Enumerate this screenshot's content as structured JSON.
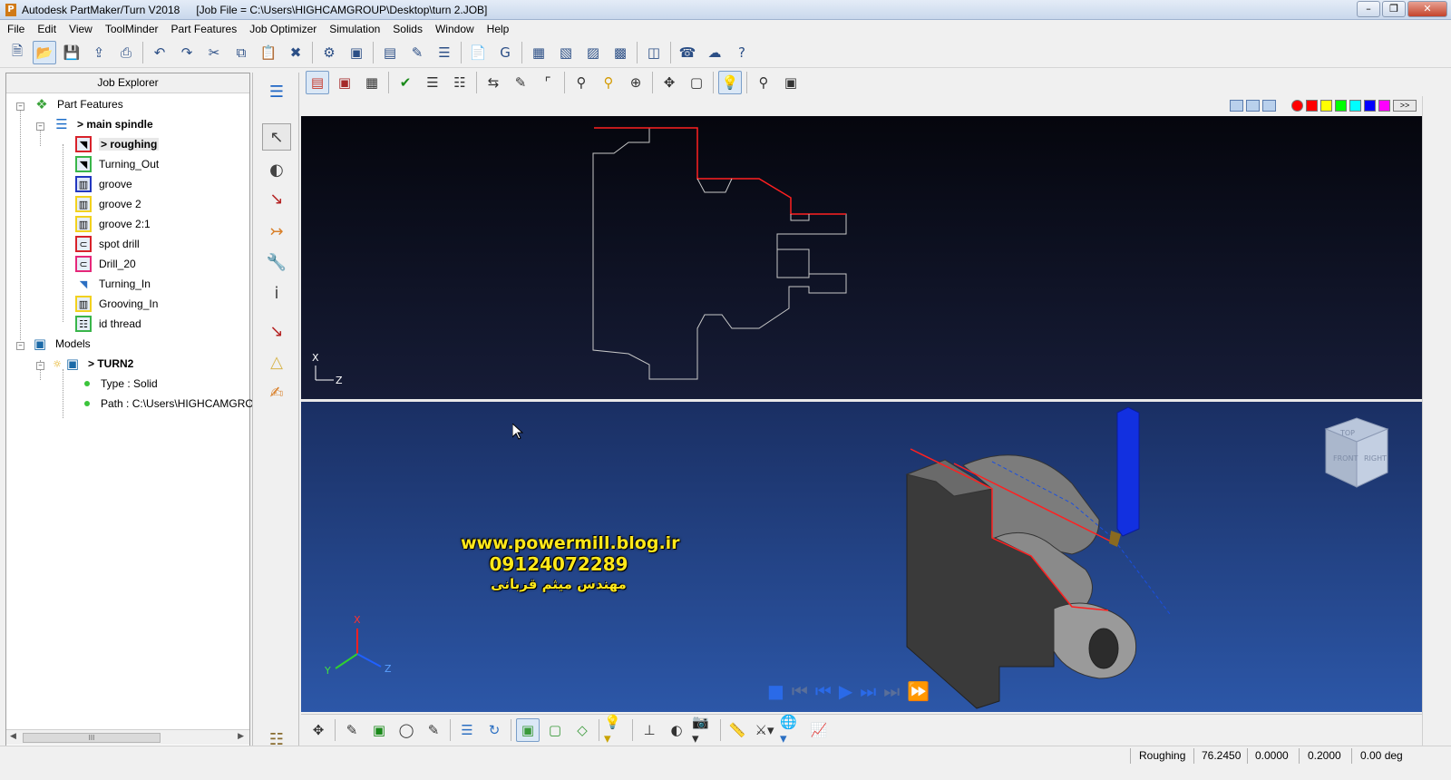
{
  "window": {
    "app_title": "Autodesk PartMaker/Turn V2018",
    "job_file": "[Job File = C:\\Users\\HIGHCAMGROUP\\Desktop\\turn 2.JOB]",
    "app_icon_letter": "P"
  },
  "menu": [
    "File",
    "Edit",
    "View",
    "ToolMinder",
    "Part Features",
    "Job Optimizer",
    "Simulation",
    "Solids",
    "Window",
    "Help"
  ],
  "explorer": {
    "title": "Job Explorer",
    "scroll_thumb": "III",
    "part_features": "Part Features",
    "main_spindle": "> main spindle",
    "features": [
      {
        "label": "> roughing",
        "color": "red",
        "icon": "turning-icon"
      },
      {
        "label": "Turning_Out",
        "color": "green",
        "icon": "turning-icon"
      },
      {
        "label": "groove",
        "color": "blue",
        "icon": "groove-icon"
      },
      {
        "label": "groove 2",
        "color": "yellow",
        "icon": "groove-icon"
      },
      {
        "label": "groove 2:1",
        "color": "yellow",
        "icon": "groove-icon"
      },
      {
        "label": "spot drill",
        "color": "red",
        "icon": "drill-icon"
      },
      {
        "label": "Drill_20",
        "color": "pink",
        "icon": "drill-icon"
      },
      {
        "label": "Turning_In",
        "color": "plain",
        "icon": "turning-icon"
      },
      {
        "label": "Grooving_In",
        "color": "yellow",
        "icon": "groove-icon"
      },
      {
        "label": "id thread",
        "color": "green",
        "icon": "thread-icon"
      }
    ],
    "models": "Models",
    "model_name": "> TURN2",
    "model_type": "Type : Solid",
    "model_path": "Path : C:\\Users\\HIGHCAMGRO"
  },
  "viewport_top": {
    "axis_x": "X",
    "axis_z": "Z"
  },
  "viewport_bottom": {
    "watermark_url": "www.powermill.blog.ir",
    "watermark_phone": "09124072289",
    "watermark_name": "مهندس میثم قربانی",
    "axis_x": "X",
    "axis_y": "Y",
    "axis_z": "Z",
    "cube_labels": [
      "TOP",
      "FRONT",
      "RIGHT"
    ]
  },
  "colors": {
    "swatches": [
      "#ff0000",
      "#ff0000",
      "#ffff00",
      "#00ff00",
      "#00ffff",
      "#0000ff",
      "#ff00ff"
    ],
    "more_label": ">>",
    "profile_red": "#ff2020",
    "tool_blue": "#1230e0"
  },
  "status": {
    "operation": "Roughing",
    "value1": "76.2450",
    "value2": "0.0000",
    "value3": "0.2000",
    "angle": "0.00 deg"
  }
}
